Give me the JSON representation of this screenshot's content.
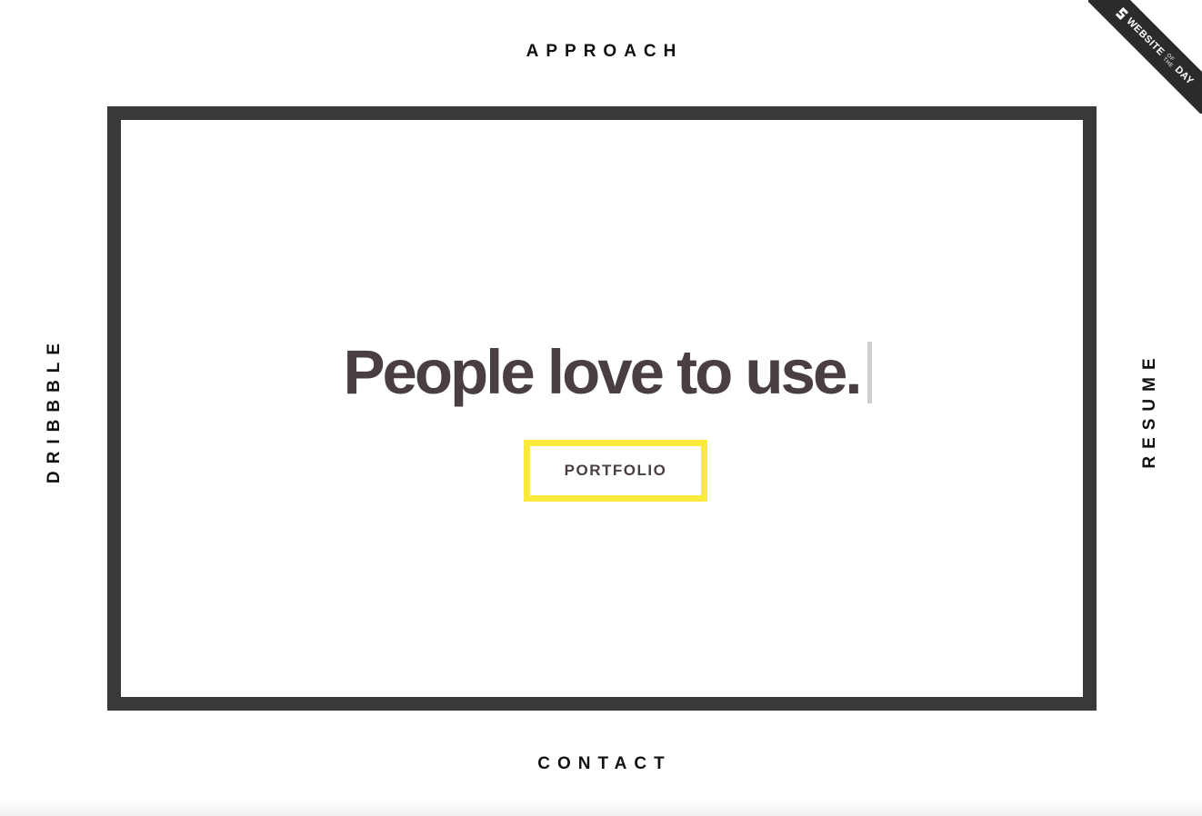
{
  "nav": {
    "top": "APPROACH",
    "bottom": "CONTACT",
    "left": "DRIBBBLE",
    "right": "RESUME"
  },
  "hero": {
    "headline": "People love to use.",
    "cta_label": "PORTFOLIO"
  },
  "badge": {
    "main": "WEBSITE",
    "small_top": "OF",
    "small_bottom": "THE",
    "end": "DAY",
    "icon": "awwwards-s-logo-icon"
  },
  "colors": {
    "frame": "#3a3839",
    "headline": "#4a3f40",
    "cta_border": "#f9ea3c",
    "nav_text": "#111111",
    "ribbon": "#2b2b2b"
  }
}
